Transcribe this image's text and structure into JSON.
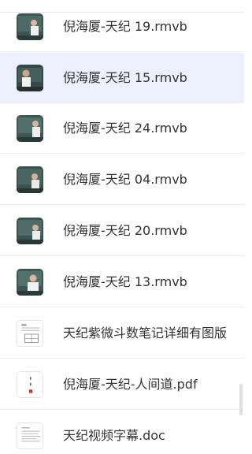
{
  "files": [
    {
      "name": "倪海厦-天纪 19.rmvb",
      "icon": "video-thumbnail-icon"
    },
    {
      "name": "倪海厦-天纪 15.rmvb",
      "icon": "video-thumbnail-icon",
      "selected": true
    },
    {
      "name": "倪海厦-天纪 24.rmvb",
      "icon": "video-thumbnail-icon"
    },
    {
      "name": "倪海厦-天纪 04.rmvb",
      "icon": "video-thumbnail-icon"
    },
    {
      "name": "倪海厦-天纪 20.rmvb",
      "icon": "video-thumbnail-icon"
    },
    {
      "name": "倪海厦-天纪 13.rmvb",
      "icon": "video-thumbnail-icon"
    },
    {
      "name": "天纪紫微斗数笔记详细有图版",
      "icon": "document-thumbnail-icon"
    },
    {
      "name": "倪海厦-天纪-人间道.pdf",
      "icon": "pdf-thumbnail-icon"
    },
    {
      "name": "天纪视频字幕.doc",
      "icon": "doc-thumbnail-icon"
    }
  ],
  "colors": {
    "selected_row": "#eceffc",
    "text": "#333333",
    "divider": "#eeeeee"
  }
}
